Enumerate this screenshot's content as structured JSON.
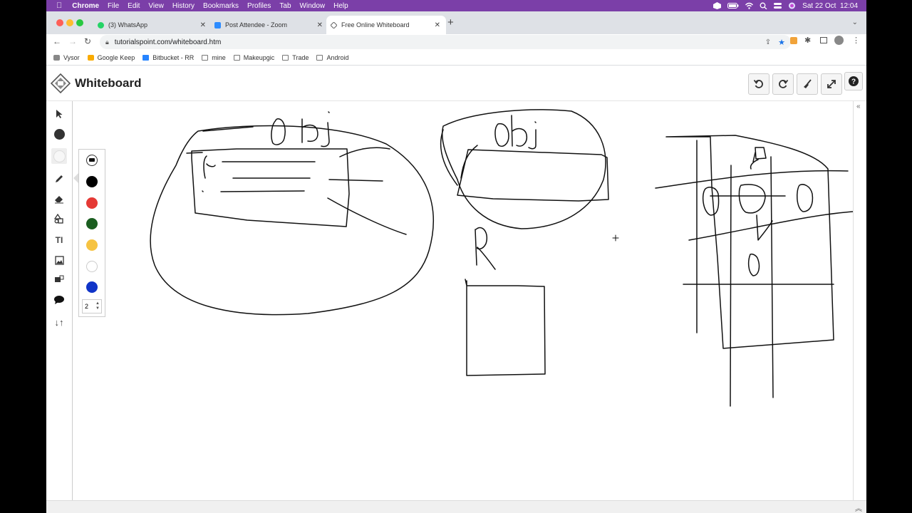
{
  "menubar": {
    "app": "Chrome",
    "items": [
      "File",
      "Edit",
      "View",
      "History",
      "Bookmarks",
      "Profiles",
      "Tab",
      "Window",
      "Help"
    ],
    "datetime": "Sat 22 Oct  12:04"
  },
  "tabs": [
    {
      "title": "(3) WhatsApp",
      "icon": "whatsapp-icon",
      "color": "#25d366"
    },
    {
      "title": "Post Attendee - Zoom",
      "icon": "zoom-icon",
      "color": "#2d8cff"
    },
    {
      "title": "Free Online Whiteboard",
      "icon": "whiteboard-icon",
      "color": "#666666",
      "active": true
    }
  ],
  "address": {
    "url": "tutorialspoint.com/whiteboard.htm"
  },
  "bookmarks": [
    {
      "label": "Vysor",
      "icon": "vysor-icon"
    },
    {
      "label": "Google Keep",
      "icon": "keep-icon"
    },
    {
      "label": "Bitbucket - RR",
      "icon": "bitbucket-icon"
    },
    {
      "label": "mine",
      "icon": "folder-icon"
    },
    {
      "label": "Makeupgic",
      "icon": "folder-icon"
    },
    {
      "label": "Trade",
      "icon": "folder-icon"
    },
    {
      "label": "Android",
      "icon": "folder-icon"
    }
  ],
  "app": {
    "title": "Whiteboard"
  },
  "palette": {
    "colors": [
      "#000000",
      "#e53935",
      "#1b5e20",
      "#f6c342",
      "#ffffff",
      "#1034c8"
    ],
    "brush_size": "2"
  },
  "canvas_text": {
    "label_top_left": "obj",
    "label_top_middle": "obj",
    "letter_r": "R"
  }
}
